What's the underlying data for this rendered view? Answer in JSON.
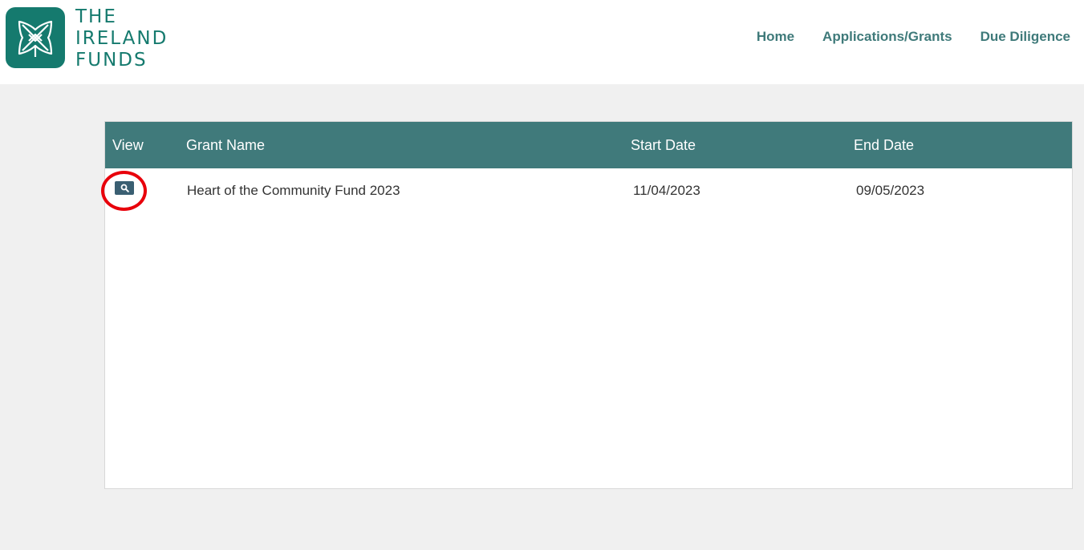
{
  "brand": {
    "name_lines": [
      "THE",
      "IRELAND",
      "FUNDS"
    ],
    "logo_icon": "shamrock-knot-icon",
    "color": "#157a6e"
  },
  "nav": {
    "home": "Home",
    "applications": "Applications/Grants",
    "due_diligence": "Due Diligence"
  },
  "table": {
    "headers": {
      "view": "View",
      "grant_name": "Grant Name",
      "start_date": "Start Date",
      "end_date": "End Date"
    },
    "rows": [
      {
        "view_icon": "magnifier-icon",
        "grant_name": "Heart of the Community Fund 2023",
        "start_date": "11/04/2023",
        "end_date": "09/05/2023"
      }
    ]
  },
  "colors": {
    "header_bg": "#407a7b",
    "nav_text": "#3f7a7a",
    "view_button": "#3a5f72",
    "highlight": "#e8000b",
    "page_bg": "#f0f0f0"
  }
}
